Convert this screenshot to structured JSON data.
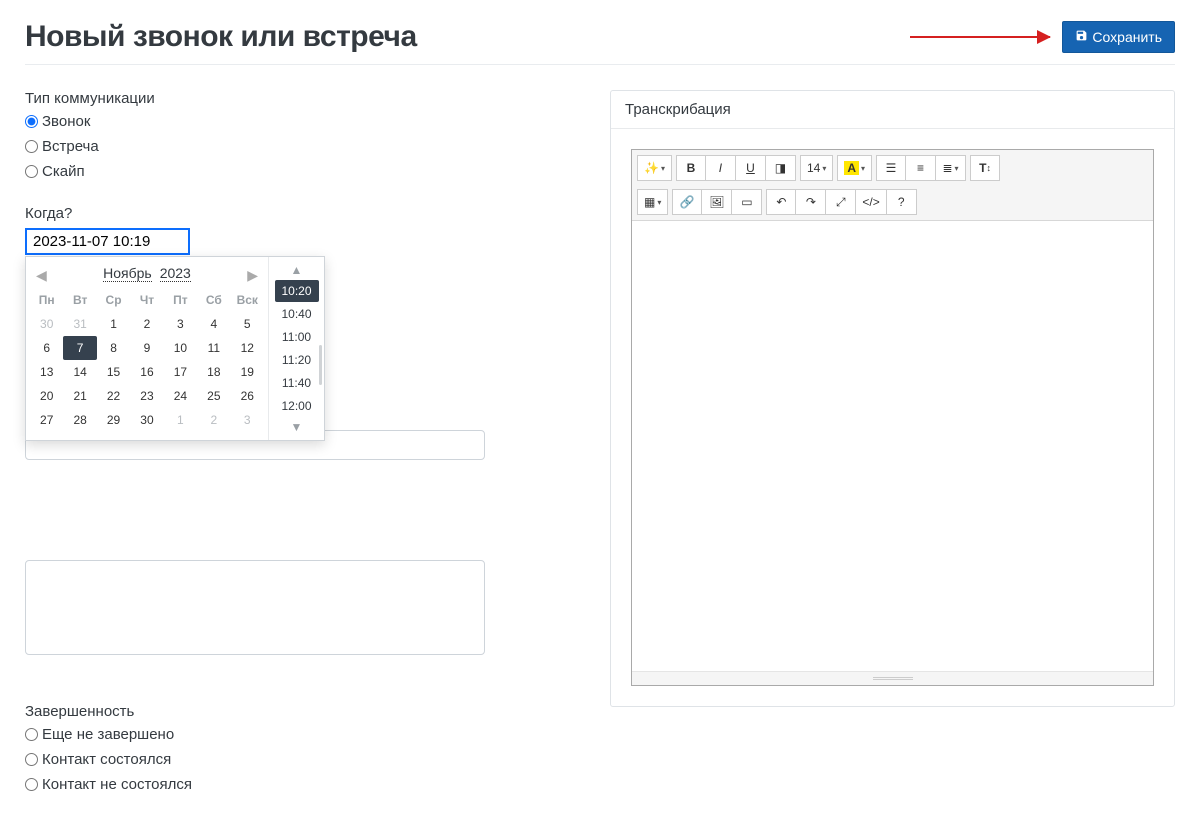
{
  "header": {
    "title": "Новый звонок или встреча",
    "save_label": "Сохранить"
  },
  "left": {
    "type_label": "Тип коммуникации",
    "type_options": [
      {
        "label": "Звонок",
        "checked": true
      },
      {
        "label": "Встреча",
        "checked": false
      },
      {
        "label": "Скайп",
        "checked": false
      }
    ],
    "when_label": "Когда?",
    "when_value": "2023-11-07 10:19",
    "calendar": {
      "month": "Ноябрь",
      "year": "2023",
      "dow": [
        "Пн",
        "Вт",
        "Ср",
        "Чт",
        "Пт",
        "Сб",
        "Вск"
      ],
      "weeks": [
        [
          {
            "d": "30",
            "dim": true
          },
          {
            "d": "31",
            "dim": true
          },
          {
            "d": "1"
          },
          {
            "d": "2"
          },
          {
            "d": "3"
          },
          {
            "d": "4"
          },
          {
            "d": "5"
          }
        ],
        [
          {
            "d": "6"
          },
          {
            "d": "7",
            "sel": true
          },
          {
            "d": "8"
          },
          {
            "d": "9"
          },
          {
            "d": "10"
          },
          {
            "d": "11"
          },
          {
            "d": "12"
          }
        ],
        [
          {
            "d": "13"
          },
          {
            "d": "14"
          },
          {
            "d": "15"
          },
          {
            "d": "16"
          },
          {
            "d": "17"
          },
          {
            "d": "18"
          },
          {
            "d": "19"
          }
        ],
        [
          {
            "d": "20"
          },
          {
            "d": "21"
          },
          {
            "d": "22"
          },
          {
            "d": "23"
          },
          {
            "d": "24"
          },
          {
            "d": "25"
          },
          {
            "d": "26"
          }
        ],
        [
          {
            "d": "27"
          },
          {
            "d": "28"
          },
          {
            "d": "29"
          },
          {
            "d": "30"
          },
          {
            "d": "1",
            "dim": true
          },
          {
            "d": "2",
            "dim": true
          },
          {
            "d": "3",
            "dim": true
          }
        ]
      ],
      "times": [
        {
          "t": "10:20",
          "sel": true
        },
        {
          "t": "10:40"
        },
        {
          "t": "11:00"
        },
        {
          "t": "11:20"
        },
        {
          "t": "11:40"
        },
        {
          "t": "12:00"
        }
      ]
    },
    "completion_label": "Завершенность",
    "completion_options": [
      {
        "label": "Еще не завершено",
        "checked": false
      },
      {
        "label": "Контакт состоялся",
        "checked": false
      },
      {
        "label": "Контакт не состоялся",
        "checked": false
      }
    ]
  },
  "right": {
    "panel_title": "Транскрибация",
    "toolbar": {
      "fontsize": "14"
    }
  }
}
